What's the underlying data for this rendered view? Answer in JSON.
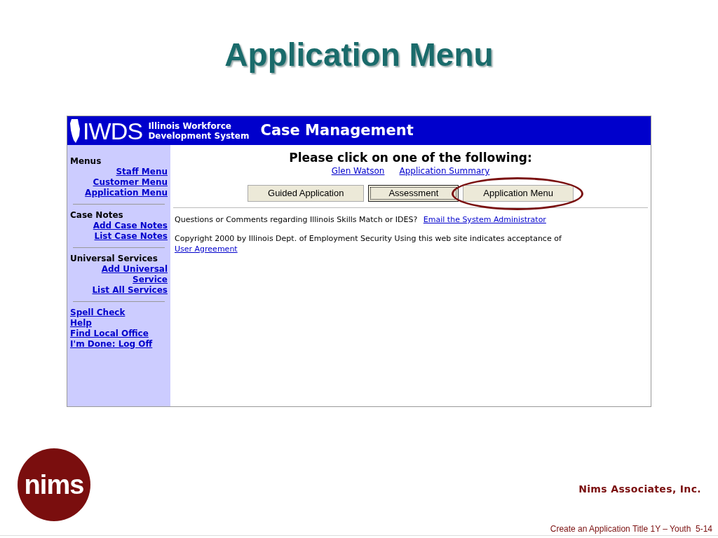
{
  "slide": {
    "title": "Application Menu",
    "company": "Nims Associates, Inc.",
    "footer": "Create an Application Title 1Y – Youth  5-14",
    "logo_text": "nims"
  },
  "app": {
    "header": {
      "logo": "IWDS",
      "subtitle_lines": [
        "Illinois Workforce",
        "Development System"
      ],
      "title": "Case Management"
    },
    "sidebar": {
      "sections": [
        {
          "heading": "Menus",
          "links": [
            "Staff Menu",
            "Customer Menu",
            "Application Menu"
          ]
        },
        {
          "heading": "Case Notes",
          "links": [
            "Add Case Notes",
            "List Case Notes"
          ]
        },
        {
          "heading": "Universal Services",
          "links": [
            "Add Universal Service",
            "List All Services"
          ]
        },
        {
          "links": [
            "Spell Check",
            "Help",
            "Find Local Office",
            "I'm Done: Log Off"
          ]
        }
      ]
    },
    "main": {
      "prompt": "Please click on one of the following:",
      "links": [
        "Glen Watson",
        "Application Summary"
      ],
      "buttons": [
        {
          "label": "Guided Application",
          "focused": false,
          "circled": false
        },
        {
          "label": "Assessment",
          "focused": true,
          "circled": false
        },
        {
          "label": "Application Menu",
          "focused": false,
          "circled": true
        }
      ],
      "questions": {
        "text": "Questions or Comments regarding Illinois Skills Match or IDES?",
        "link": "Email the System Administrator"
      },
      "copyright": {
        "text": "Copyright 2000 by Illinois Dept. of Employment Security Using this web site indicates acceptance of",
        "link": "User Agreement"
      }
    }
  }
}
